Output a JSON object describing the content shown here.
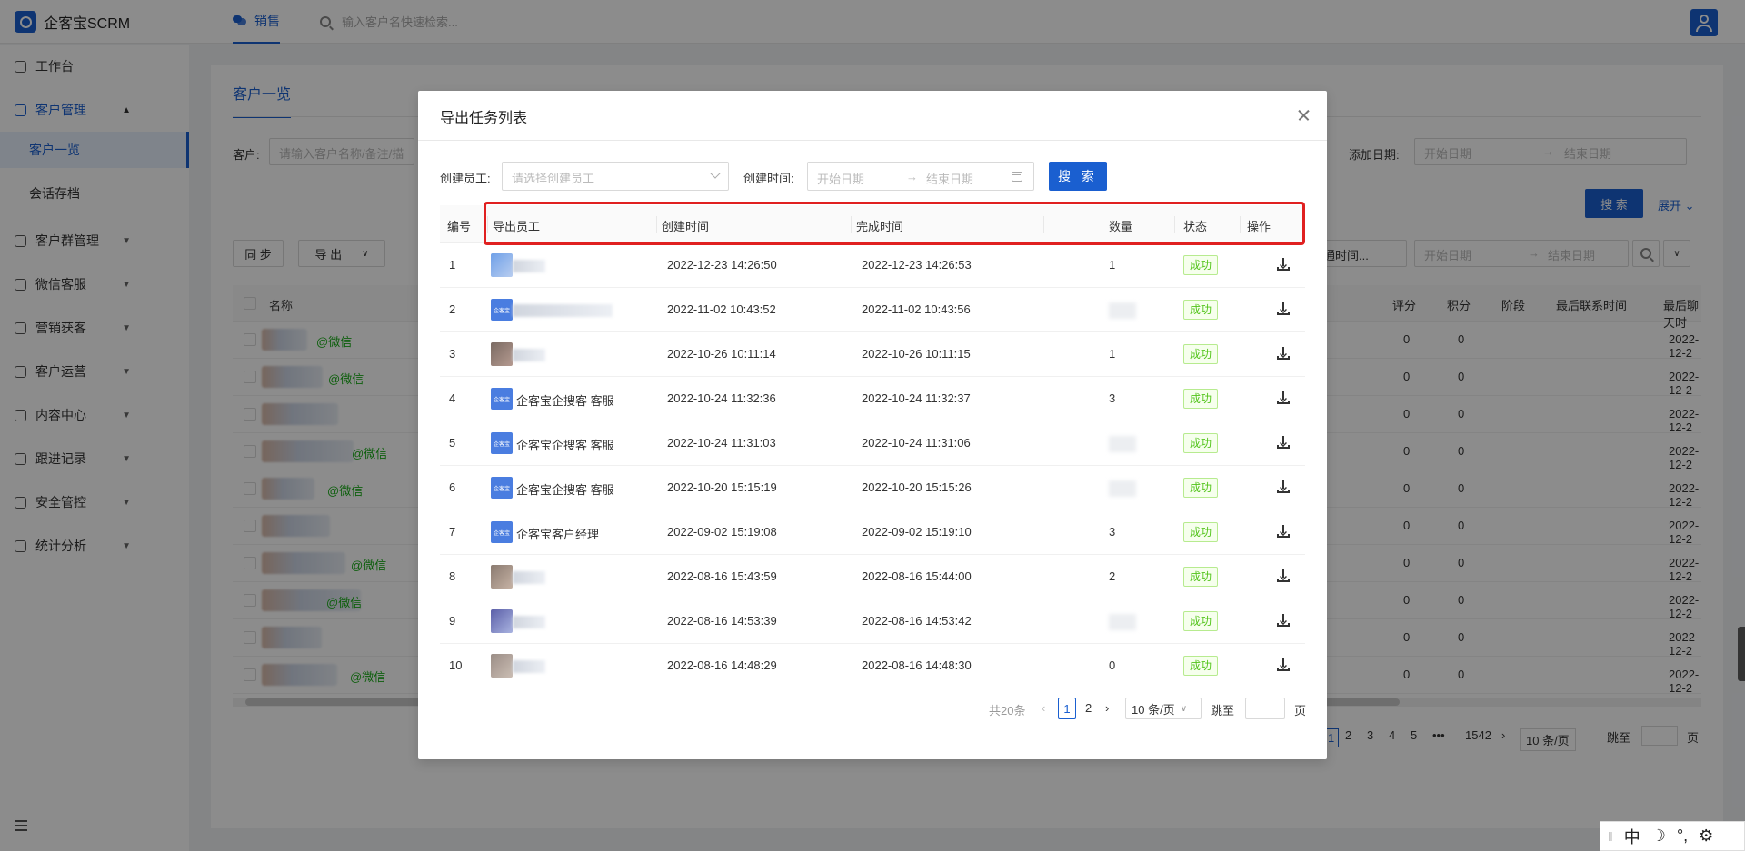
{
  "topbar": {
    "app_name": "企客宝SCRM",
    "nav_tab": "销售",
    "search_placeholder": "输入客户名快速检索..."
  },
  "sidebar": {
    "items": [
      {
        "label": "工作台",
        "icon": "dashboard-icon"
      },
      {
        "label": "客户管理",
        "icon": "customer-icon",
        "open": true
      },
      {
        "label": "客户群管理",
        "icon": "group-chat-icon"
      },
      {
        "label": "微信客服",
        "icon": "service-icon"
      },
      {
        "label": "营销获客",
        "icon": "marketing-icon"
      },
      {
        "label": "客户运营",
        "icon": "operation-icon"
      },
      {
        "label": "内容中心",
        "icon": "content-icon"
      },
      {
        "label": "跟进记录",
        "icon": "record-icon"
      },
      {
        "label": "安全管控",
        "icon": "shield-icon"
      },
      {
        "label": "统计分析",
        "icon": "chart-icon"
      }
    ],
    "sub_items": [
      "客户一览",
      "会话存档"
    ]
  },
  "main": {
    "tab": "客户一览",
    "customer_label": "客户:",
    "customer_placeholder": "请输入客户名称/备注/描",
    "add_date_label": "添加日期:",
    "start_date": "开始日期",
    "end_date": "结束日期",
    "search_btn": "搜 索",
    "expand": "展开",
    "sync_btn": "同 步",
    "export_btn": "导 出",
    "open_time_select": "开通时间...",
    "table_headers": [
      "名称",
      "评分",
      "积分",
      "阶段",
      "最后联系时间",
      "最后聊天时"
    ],
    "row_wechat": [
      "@微信",
      "@微信",
      "",
      "@微信",
      "@微信",
      "",
      "@微信",
      "@微信",
      "",
      "@微信"
    ],
    "row_score": "0",
    "row_points": "0",
    "row_last_chat": "2022-12-2",
    "pager": {
      "pages": [
        "1",
        "2",
        "3",
        "4",
        "5",
        "•••",
        "1542"
      ],
      "size": "10 条/页",
      "jump": "跳至",
      "page_unit": "页"
    }
  },
  "modal": {
    "title": "导出任务列表",
    "creator_label": "创建员工:",
    "creator_placeholder": "请选择创建员工",
    "created_time_label": "创建时间:",
    "start_date": "开始日期",
    "end_date": "结束日期",
    "search_btn": "搜 索",
    "columns": [
      "编号",
      "导出员工",
      "创建时间",
      "完成时间",
      "数量",
      "状态",
      "操作"
    ],
    "rows": [
      {
        "no": "1",
        "employee": "",
        "logo": false,
        "created": "2022-12-23 14:26:50",
        "finished": "2022-12-23 14:26:53",
        "count": "1",
        "status": "成功"
      },
      {
        "no": "2",
        "employee": "",
        "logo": true,
        "created": "2022-11-02 10:43:52",
        "finished": "2022-11-02 10:43:56",
        "count": "",
        "status": "成功"
      },
      {
        "no": "3",
        "employee": "",
        "logo": false,
        "created": "2022-10-26 10:11:14",
        "finished": "2022-10-26 10:11:15",
        "count": "1",
        "status": "成功"
      },
      {
        "no": "4",
        "employee": "企客宝企搜客 客服",
        "logo": true,
        "created": "2022-10-24 11:32:36",
        "finished": "2022-10-24 11:32:37",
        "count": "3",
        "status": "成功"
      },
      {
        "no": "5",
        "employee": "企客宝企搜客 客服",
        "logo": true,
        "created": "2022-10-24 11:31:03",
        "finished": "2022-10-24 11:31:06",
        "count": "",
        "status": "成功"
      },
      {
        "no": "6",
        "employee": "企客宝企搜客 客服",
        "logo": true,
        "created": "2022-10-20 15:15:19",
        "finished": "2022-10-20 15:15:26",
        "count": "",
        "status": "成功"
      },
      {
        "no": "7",
        "employee": "企客宝客户经理",
        "logo": true,
        "created": "2022-09-02 15:19:08",
        "finished": "2022-09-02 15:19:10",
        "count": "3",
        "status": "成功"
      },
      {
        "no": "8",
        "employee": "",
        "logo": false,
        "created": "2022-08-16 15:43:59",
        "finished": "2022-08-16 15:44:00",
        "count": "2",
        "status": "成功"
      },
      {
        "no": "9",
        "employee": "",
        "logo": false,
        "created": "2022-08-16 14:53:39",
        "finished": "2022-08-16 14:53:42",
        "count": "",
        "status": "成功"
      },
      {
        "no": "10",
        "employee": "",
        "logo": false,
        "created": "2022-08-16 14:48:29",
        "finished": "2022-08-16 14:48:30",
        "count": "0",
        "status": "成功"
      }
    ],
    "pager": {
      "total": "共20条",
      "pages": [
        "1",
        "2"
      ],
      "current": "1",
      "size": "10 条/页",
      "jump": "跳至",
      "page_unit": "页"
    }
  },
  "ime": {
    "lang": "中",
    "moon": "☽",
    "punct": "°,",
    "gear": "⚙"
  },
  "colors": {
    "primary": "#1a5fd0",
    "success": "#52c41a",
    "highlight": "#e02020"
  }
}
